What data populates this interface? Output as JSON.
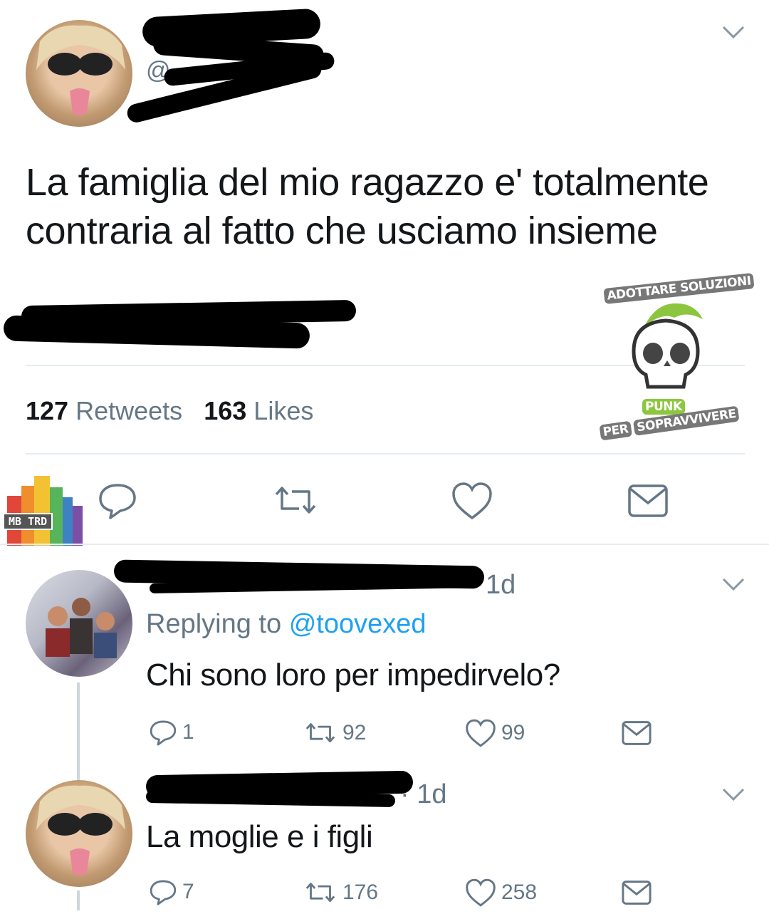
{
  "tweet": {
    "handle_prefix": "@",
    "text": "La famiglia del mio ragazzo e' totalmente contraria al fatto che usciamo insieme",
    "retweets_count": "127",
    "retweets_label": "Retweets",
    "likes_count": "163",
    "likes_label": "Likes"
  },
  "watermark_punk": {
    "top": "ADOTTARE SOLUZIONI",
    "middle": "PUNK",
    "bottom_a": "PER",
    "bottom_b": "SOPRAVVIVERE"
  },
  "watermark_mb": {
    "text": "MB TRD"
  },
  "replies": [
    {
      "time": "1d",
      "replying_prefix": "Replying to",
      "replying_handle": "@toovexed",
      "text": "Chi sono loro per impedirvelo?",
      "reply_count": "1",
      "retweet_count": "92",
      "like_count": "99"
    },
    {
      "time": "· 1d",
      "text": "La moglie e i figli",
      "reply_count": "7",
      "retweet_count": "176",
      "like_count": "258"
    }
  ],
  "colors": {
    "text": "#14171a",
    "muted": "#657786",
    "divider": "#e6ecf0",
    "punk_green": "#8cc63f"
  },
  "icons": [
    "chevron-down-icon",
    "reply-icon",
    "retweet-icon",
    "like-icon",
    "dm-icon"
  ]
}
